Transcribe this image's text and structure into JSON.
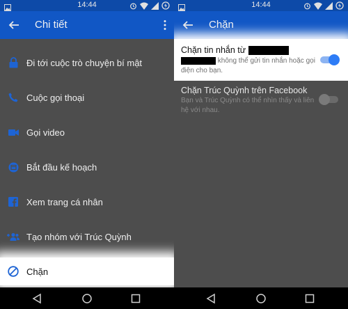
{
  "status_bar": {
    "time": "14:44"
  },
  "left_screen": {
    "title": "Chi tiết",
    "menu": [
      {
        "label": "Đi tới cuộc trò chuyện bí mật",
        "icon": "lock-icon"
      },
      {
        "label": "Cuộc gọi thoại",
        "icon": "phone-icon"
      },
      {
        "label": "Gọi video",
        "icon": "video-camera-icon"
      },
      {
        "label": "Bắt đầu kế hoạch",
        "icon": "calendar-icon"
      },
      {
        "label": "Xem trang cá nhân",
        "icon": "facebook-icon"
      },
      {
        "label": "Tạo nhóm với Trúc Quỳnh",
        "icon": "add-group-icon"
      },
      {
        "label": "Chặn",
        "icon": "block-icon"
      }
    ]
  },
  "right_screen": {
    "title": "Chặn",
    "block_messages": {
      "title": "Chặn tin nhắn từ",
      "description": "không thể gửi tin nhắn hoặc gọi điện cho bạn.",
      "enabled": true
    },
    "block_facebook": {
      "title": "Chặn Trúc Quỳnh trên Facebook",
      "description": "Bạn và Trúc Quỳnh có thể nhìn thấy và liên hệ với nhau.",
      "enabled": false
    }
  },
  "colors": {
    "accent": "#1157c5",
    "statusbar": "#0d4aa8",
    "toggle_on": "#2e7cf6",
    "dim_bg": "#4d4d4d"
  }
}
